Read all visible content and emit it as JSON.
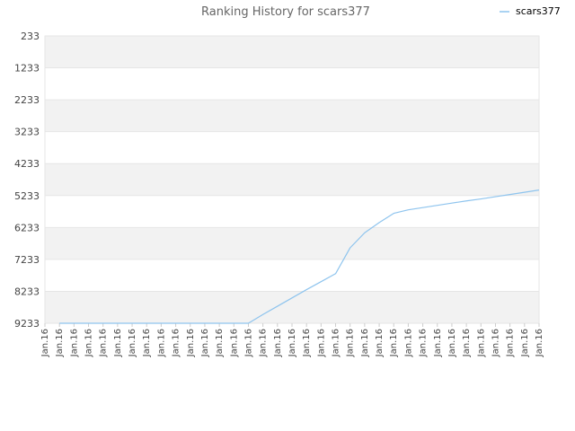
{
  "chart_data": {
    "type": "line",
    "title": "Ranking History for scars377",
    "xlabel": "",
    "ylabel": "",
    "y_inverted": true,
    "ylim": [
      233,
      9233
    ],
    "yticks": [
      233,
      1233,
      2233,
      3233,
      4233,
      5233,
      6233,
      7233,
      8233,
      9233
    ],
    "legend": {
      "position": "top-right"
    },
    "colors": {
      "line": "#8ec4ee",
      "band": "#f2f2f2",
      "grid": "#e6e6e6",
      "title": "#666666"
    },
    "x": [
      "Jan.16",
      "Jan.16",
      "Jan.16",
      "Jan.16",
      "Jan.16",
      "Jan.16",
      "Jan.16",
      "Jan.16",
      "Jan.16",
      "Jan.16",
      "Jan.16",
      "Jan.16",
      "Jan.16",
      "Jan.16",
      "Jan.16",
      "Jan.16",
      "Jan.16",
      "Jan.16",
      "Jan.16",
      "Jan.16",
      "Jan.16",
      "Jan.16",
      "Jan.16",
      "Jan.16",
      "Jan.16",
      "Jan.16",
      "Jan.16",
      "Jan.16",
      "Jan.16",
      "Jan.16",
      "Jan.16",
      "Jan.16",
      "Jan.16",
      "Jan.16",
      "Jan.16"
    ],
    "series": [
      {
        "name": "scars377",
        "values": [
          null,
          9233,
          9233,
          9233,
          9233,
          9233,
          9233,
          9233,
          9233,
          9233,
          9233,
          9233,
          9233,
          9233,
          9233,
          8960,
          8700,
          8440,
          8180,
          7930,
          7680,
          6870,
          6400,
          6080,
          5790,
          5680,
          5610,
          5540,
          5470,
          5400,
          5340,
          5270,
          5200,
          5130,
          5060
        ]
      }
    ]
  }
}
